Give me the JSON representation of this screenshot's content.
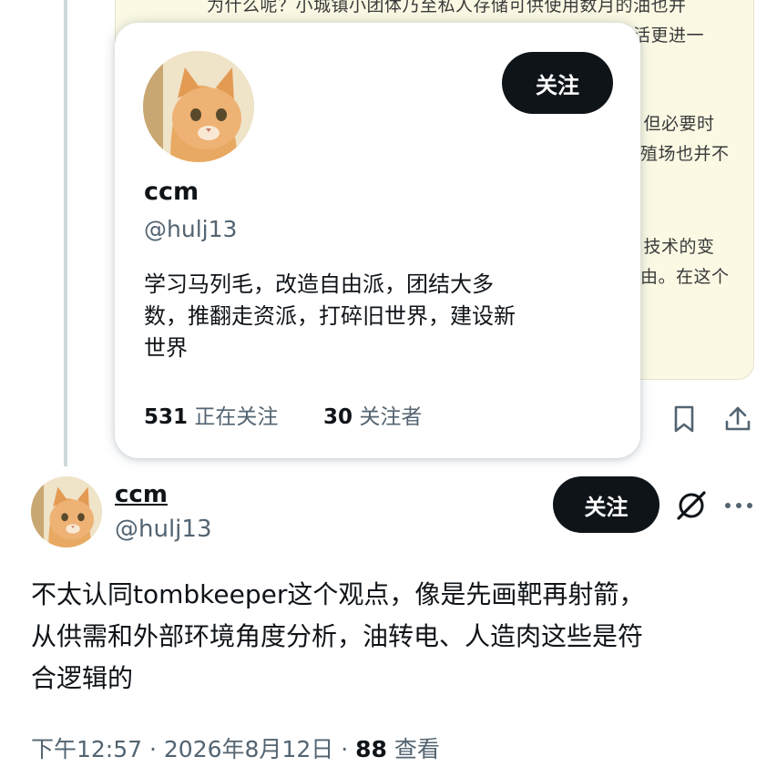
{
  "quoted_tweet": {
    "lines": [
      "为什么呢？小城镇小团体乃至私人存储可供使用数月的油也并",
      "不难，而太阳能以车储能，这改车必然另改变我们的生活更进一",
      "，但必要时",
      "殖场也并不",
      "：技术的变",
      "由。在这个"
    ]
  },
  "popup": {
    "name": "ccm",
    "handle": "@hulj13",
    "follow_label": "关注",
    "bio_lines": [
      "学习马列毛，改造自由派，团结大多",
      "数，推翻走资派，打碎旧世界，建设新",
      "世界"
    ],
    "following_count": "531",
    "following_label": "正在关注",
    "followers_count": "30",
    "followers_label": "关注者"
  },
  "main_tweet": {
    "name": "ccm",
    "handle": "@hulj13",
    "follow_label": "关注",
    "text_lines": [
      "不太认同tombkeeper这个观点，像是先画靶再射箭，",
      "从供需和外部环境角度分析，油转电、人造肉这些是符",
      "合逻辑的"
    ],
    "time": "下午12:57",
    "sep1": "·",
    "date": "2026年8月12日",
    "sep2": "·",
    "views_count": "88",
    "views_label": "查看"
  },
  "icons": {
    "bookmark": "bookmark-icon",
    "share": "share-icon",
    "grok": "grok-icon",
    "more": "more-icon"
  },
  "colors": {
    "text": "#0f1419",
    "muted": "#536471",
    "quote_bg": "#fbf9e4",
    "button_bg": "#0f1419",
    "thread_line": "#cfd9de"
  }
}
